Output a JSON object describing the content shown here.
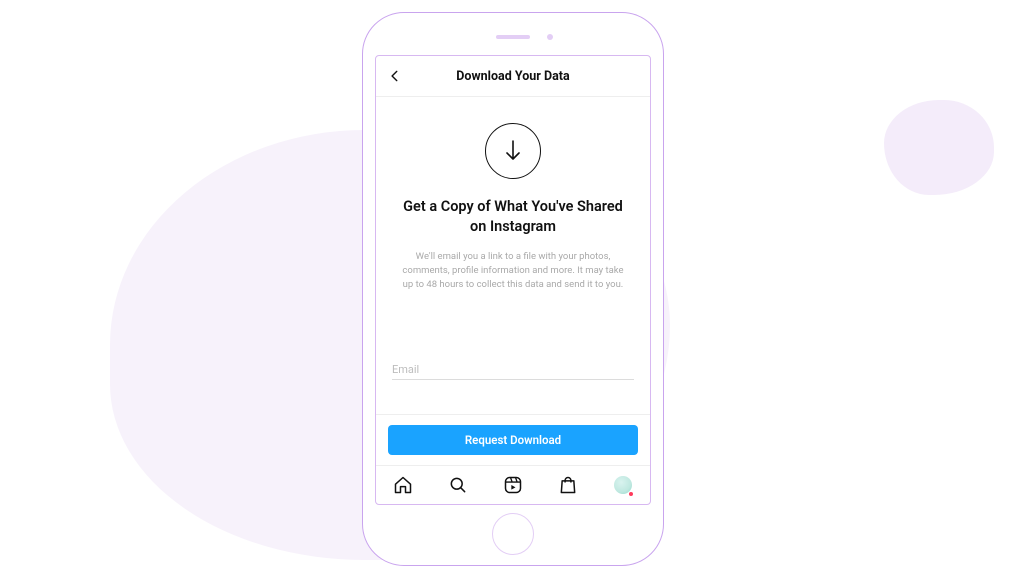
{
  "header": {
    "title": "Download Your Data"
  },
  "main": {
    "heading": "Get a Copy of What You've Shared on Instagram",
    "description": "We'll email you a link to a file with your photos, comments, profile information and more. It may take up to 48 hours to collect this data and send it to you."
  },
  "email": {
    "placeholder": "Email",
    "value": ""
  },
  "action": {
    "request_label": "Request Download"
  },
  "icons": {
    "back": "chevron-left",
    "download": "download-arrow-circle",
    "nav": [
      "home",
      "search",
      "reels",
      "shop",
      "profile"
    ]
  },
  "colors": {
    "accent": "#1aa3ff",
    "phone_outline": "#c9a4ee",
    "blob": "#f7f2fb"
  }
}
